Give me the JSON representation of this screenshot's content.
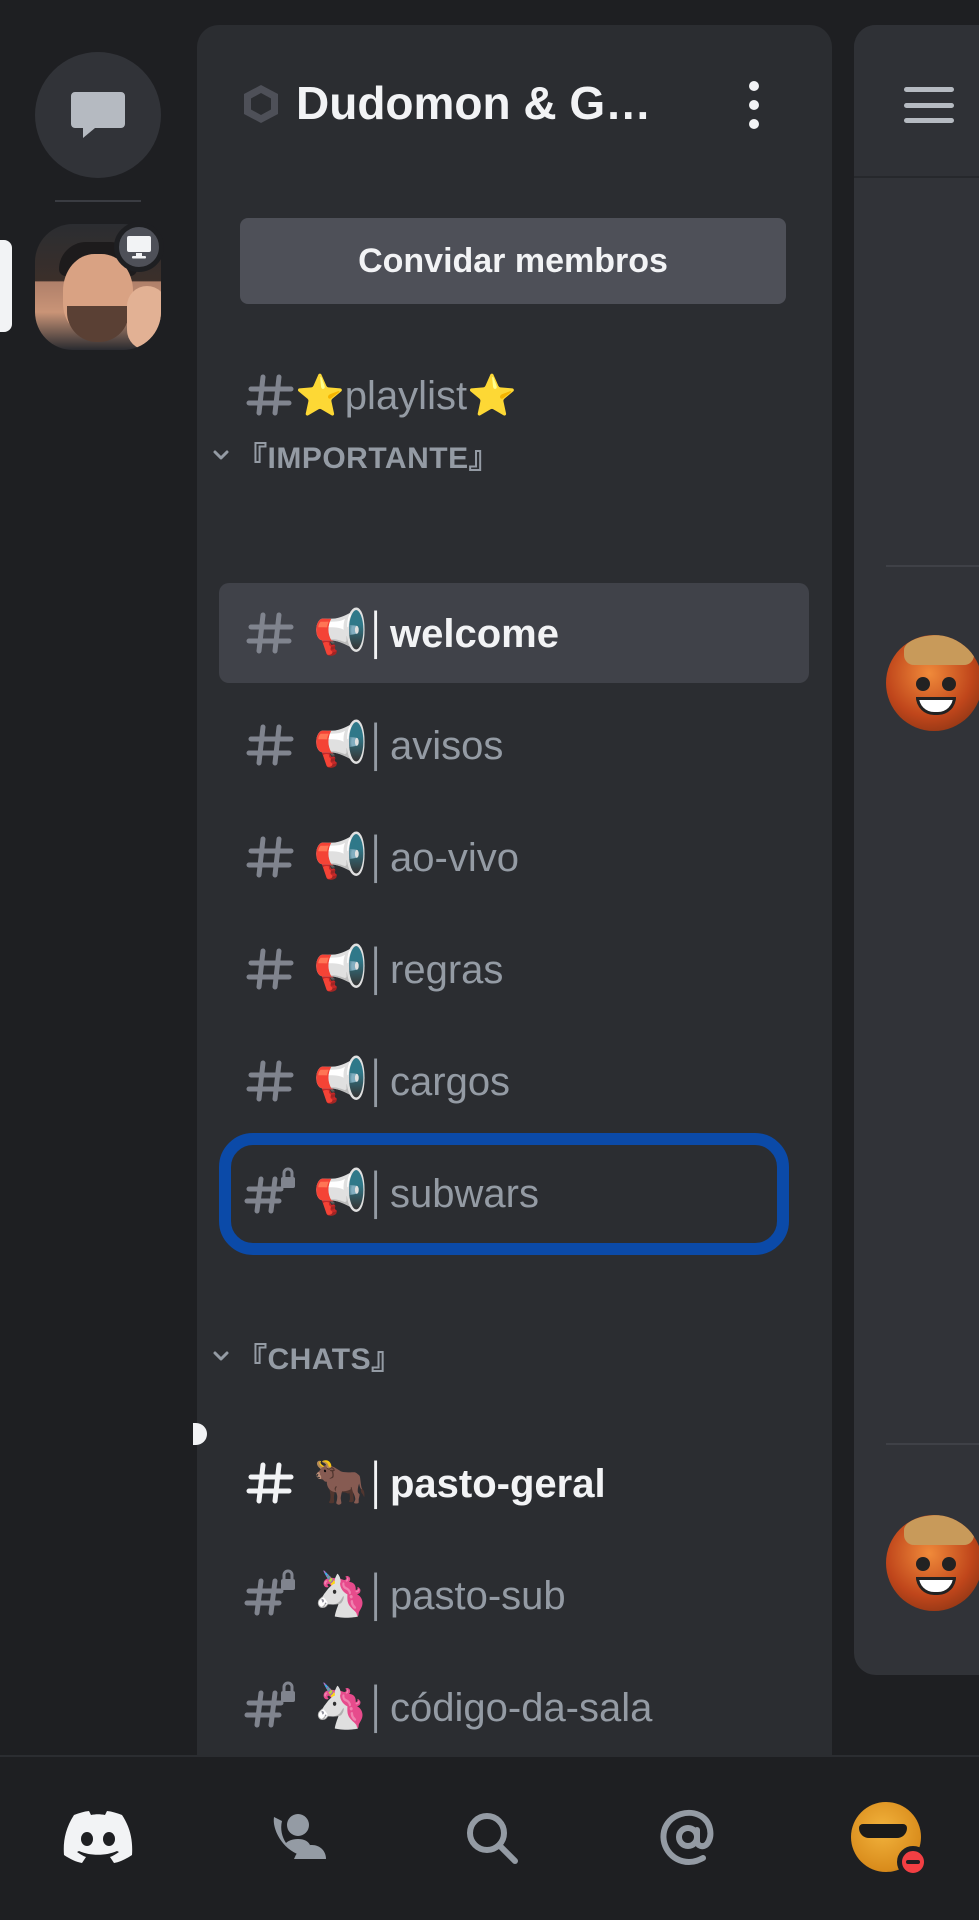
{
  "server": {
    "name": "Dudomon & Ga...",
    "invite_label": "Convidar membros"
  },
  "channels_top": [
    {
      "emoji": "⭐",
      "name": "⭐playlist⭐",
      "locked": false,
      "state": "normal"
    }
  ],
  "categories": [
    {
      "label": "『IMPORTANTE』",
      "channels": [
        {
          "emoji": "📢",
          "name": "welcome",
          "locked": false,
          "state": "selected"
        },
        {
          "emoji": "📢",
          "name": "avisos",
          "locked": false,
          "state": "normal"
        },
        {
          "emoji": "📢",
          "name": "ao-vivo",
          "locked": false,
          "state": "normal"
        },
        {
          "emoji": "📢",
          "name": "regras",
          "locked": false,
          "state": "normal"
        },
        {
          "emoji": "📢",
          "name": "cargos",
          "locked": false,
          "state": "normal"
        },
        {
          "emoji": "📢",
          "name": "subwars",
          "locked": true,
          "state": "highlighted"
        }
      ]
    },
    {
      "label": "『CHATS』",
      "channels": [
        {
          "emoji": "🐂",
          "name": "pasto-geral",
          "locked": false,
          "state": "unread"
        },
        {
          "emoji": "🦄",
          "name": "pasto-sub",
          "locked": true,
          "state": "normal"
        },
        {
          "emoji": "🦄",
          "name": "código-da-sala",
          "locked": true,
          "state": "normal"
        }
      ]
    }
  ],
  "bottom_nav": [
    {
      "icon": "discord-logo-icon",
      "active": true
    },
    {
      "icon": "friends-icon",
      "active": false
    },
    {
      "icon": "search-icon",
      "active": false
    },
    {
      "icon": "mentions-icon",
      "active": false
    },
    {
      "icon": "profile-avatar",
      "active": false,
      "status": "do-not-disturb"
    }
  ],
  "colors": {
    "background": "#1e1f22",
    "panel": "#2b2d31",
    "selected": "#404249",
    "muted_text": "#949ba4",
    "bright_text": "#f2f3f5",
    "highlight_border": "#0b4aa8",
    "dnd_red": "#f23f43"
  }
}
